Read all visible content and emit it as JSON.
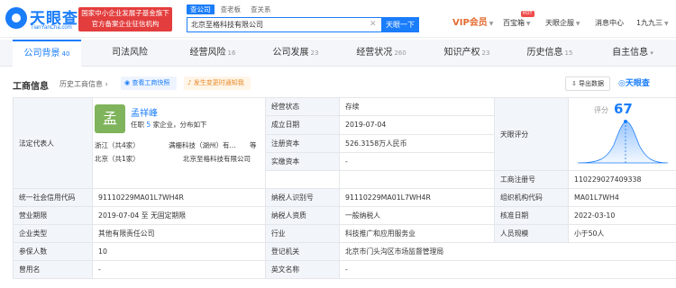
{
  "header": {
    "logo_text": "天眼查",
    "logo_sub": "TianYanCha.com",
    "banner_line1": "国家中小企业发展子基金旗下",
    "banner_line2": "官方备案企业征信机构",
    "search_tabs": [
      "查公司",
      "查老板",
      "查关系"
    ],
    "search_value": "北京至格科技有限公司",
    "search_button": "天眼一下",
    "nav": {
      "vip": "VIP会员",
      "baobaoxiang": "百宝箱",
      "hot_badge": "HOT",
      "enterprise": "天眼企服",
      "messages": "消息中心",
      "user": "1九九三"
    }
  },
  "tabs": [
    {
      "label": "公司背景",
      "count": "40"
    },
    {
      "label": "司法风险",
      "count": ""
    },
    {
      "label": "经营风险",
      "count": "16"
    },
    {
      "label": "公司发展",
      "count": "23"
    },
    {
      "label": "经营状况",
      "count": "260"
    },
    {
      "label": "知识产权",
      "count": "23"
    },
    {
      "label": "历史信息",
      "count": "15"
    },
    {
      "label": "自主信息",
      "count": ""
    }
  ],
  "section": {
    "title": "工商信息",
    "history_link": "历史工商信息",
    "quick_button": "查看工商快照",
    "notify_button": "发生变更时通知我",
    "export_button": "导出数据",
    "brand_mark": "天眼查"
  },
  "legal_rep": {
    "label": "法定代表人",
    "avatar_char": "孟",
    "name": "孟祥峰",
    "sub_prefix": "任职",
    "sub_count": "5",
    "sub_suffix": "家企业，分布如下",
    "row1_region": "浙江（共4家）",
    "row1_company": "满栅科技（湖州）有...",
    "row1_more": "等",
    "row2_region": "北京（共1家）",
    "row2_company": "北京至格科技有限公司"
  },
  "business": {
    "status_label": "经营状态",
    "status": "存续",
    "established_label": "成立日期",
    "established": "2019-07-04",
    "capital_label": "注册资本",
    "capital": "526.3158万人民币",
    "paid_capital_label": "实缴资本",
    "paid_capital": "-",
    "score_row_label": "天眼评分",
    "score_label": "评分",
    "score": "67",
    "reg_no_label": "工商注册号",
    "reg_no": "110229027409338",
    "credit_code_label": "统一社会信用代码",
    "credit_code": "91110229MA01L7WH4R",
    "taxpayer_id_label": "纳税人识别号",
    "taxpayer_id": "91110229MA01L7WH4R",
    "org_code_label": "组织机构代码",
    "org_code": "MA01L7WH4",
    "term_label": "营业期限",
    "term": "2019-07-04  至  无固定期限",
    "taxpayer_qual_label": "纳税人资质",
    "taxpayer_qual": "一般纳税人",
    "approval_date_label": "核准日期",
    "approval_date": "2022-03-10",
    "type_label": "企业类型",
    "type": "其他有限责任公司",
    "industry_label": "行业",
    "industry": "科技推广和应用服务业",
    "staff_label": "人员规模",
    "staff": "小于50人",
    "insured_label": "参保人数",
    "insured": "10",
    "authority_label": "登记机关",
    "authority": "北京市门头沟区市场监督管理局",
    "former_name_label": "曾用名",
    "former_name": "-",
    "english_name_label": "英文名称",
    "english_name": "-"
  },
  "colors": {
    "accent": "#1a7dfa",
    "banner": "#e33d3d",
    "vip": "#e36b2f",
    "avatar": "#7fb45c"
  }
}
